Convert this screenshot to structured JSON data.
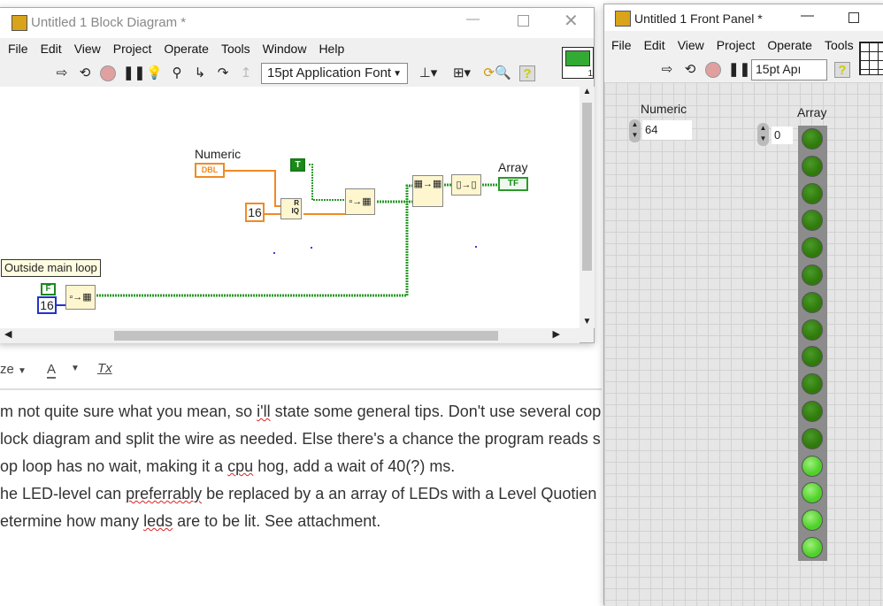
{
  "block_diagram": {
    "title": "Untitled 1 Block Diagram *",
    "menu": [
      "File",
      "Edit",
      "View",
      "Project",
      "Operate",
      "Tools",
      "Window",
      "Help"
    ],
    "font_select": "15pt Application Font",
    "nodes": {
      "numeric_label": "Numeric",
      "numeric_terminal": "DBL",
      "const_16": "16",
      "true_const": "T",
      "array_label": "Array",
      "array_terminal": "TF",
      "comment": "Outside main loop",
      "false_const": "F",
      "const_16_b": "16",
      "quotient_r": "R",
      "quotient_iq": "IQ"
    },
    "icon_number": "1"
  },
  "editor": {
    "toolbar": {
      "size_label": "ze",
      "font_color": "A",
      "clear_format": "Tx"
    },
    "lines": [
      [
        "m not quite sure what you mean, so ",
        "i'll",
        " state some general tips. Don't use several cop"
      ],
      [
        "lock diagram and split the wire as needed. Else there's a chance the program reads s"
      ],
      [
        "op loop has no wait, making it a ",
        "cpu",
        " hog, add a wait of 40(?) ms."
      ],
      [
        "he LED-level can ",
        "preferrably",
        " be replaced by a an array of LEDs with a Level Quotien"
      ],
      [
        "etermine how many ",
        "leds",
        " are to be lit. See attachment."
      ]
    ]
  },
  "front_panel": {
    "title": "Untitled 1 Front Panel *",
    "menu": [
      "File",
      "Edit",
      "View",
      "Project",
      "Operate",
      "Tools"
    ],
    "font_select": "15pt Apı",
    "numeric": {
      "label": "Numeric",
      "value": "64"
    },
    "array": {
      "label": "Array",
      "index": "0",
      "leds": [
        false,
        false,
        false,
        false,
        false,
        false,
        false,
        false,
        false,
        false,
        false,
        false,
        true,
        true,
        true,
        true
      ]
    },
    "colors": {
      "led_off": "#2f7a0a",
      "led_on": "#4fd02a"
    }
  }
}
